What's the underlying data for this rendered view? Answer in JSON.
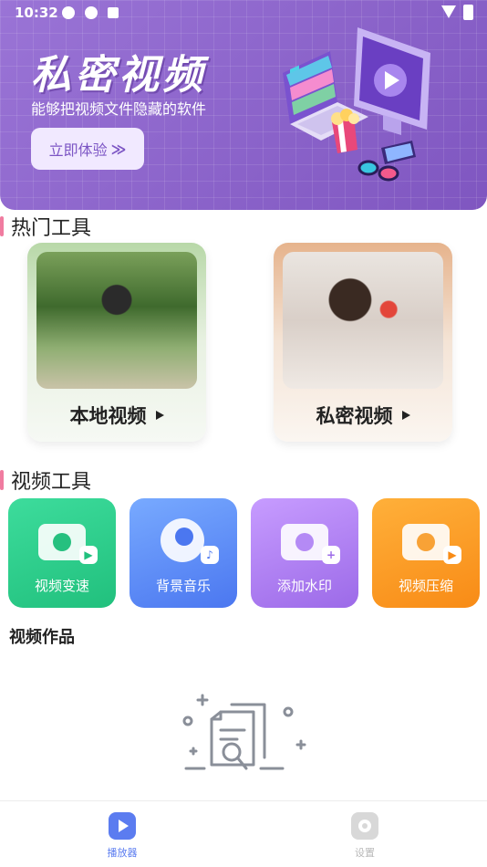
{
  "status_bar": {
    "time": "10:32"
  },
  "banner": {
    "title": "私密视频",
    "subtitle": "能够把视频文件隐藏的软件",
    "cta_label": "立即体验",
    "cta_chevron": "≫"
  },
  "hot_tools": {
    "title": "热门工具",
    "cards": [
      {
        "label": "本地视频",
        "icon": "play-icon"
      },
      {
        "label": "私密视频",
        "icon": "play-icon"
      }
    ]
  },
  "video_tools": {
    "title": "视频工具",
    "items": [
      {
        "label": "视频变速",
        "icon": "speed-icon",
        "color": "#21c07d"
      },
      {
        "label": "背景音乐",
        "icon": "music-icon",
        "color": "#4b77f0"
      },
      {
        "label": "添加水印",
        "icon": "watermark-icon",
        "color": "#9c6ae8"
      },
      {
        "label": "视频压缩",
        "icon": "compress-icon",
        "color": "#f88b16"
      }
    ]
  },
  "works": {
    "title": "视频作品"
  },
  "bottom_nav": {
    "items": [
      {
        "label": "播放器",
        "icon": "play-icon",
        "active": true,
        "color": "#5b7cf0"
      },
      {
        "label": "设置",
        "icon": "settings-icon",
        "active": false,
        "color": "#b8b8b8"
      }
    ]
  },
  "colors": {
    "banner": "#8a63c9",
    "accent_bar": "#f07ca0"
  }
}
